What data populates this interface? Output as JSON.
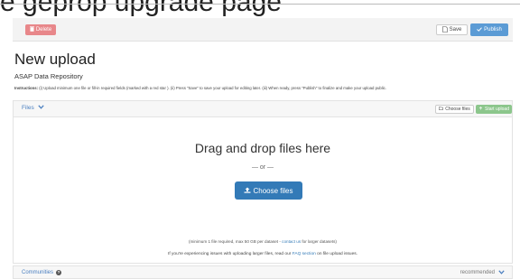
{
  "clipped_heading": "e geprop  upgrade page",
  "toolbar": {
    "delete_label": "Delete",
    "delete_icon": "trash-icon",
    "save_label": "Save",
    "save_icon": "file-icon",
    "publish_label": "Publish",
    "publish_icon": "check-icon"
  },
  "page": {
    "title": "New upload",
    "subtitle": "ASAP Data Repository",
    "instructions_label": "Instructions:",
    "instructions_text": " (i) Upload minimum one file or fill-in required fields (marked with a red star ). (ii) Press \"Save\" to save your upload for editing later. (iii) When ready, press \"Publish\" to finalize and make your upload public."
  },
  "files": {
    "header_label": "Files",
    "choose_small_label": "Choose files",
    "start_upload_label": "Start upload",
    "drop_title": "Drag and drop files here",
    "or_text": "— or —",
    "choose_big_label": "Choose files",
    "note_prefix": "(minimum 1 file required, max 50 GB per dataset - ",
    "note_link": "contact us",
    "note_suffix": " for larger datasets)",
    "issue_prefix": "If you're experiencing issues with uploading larger files, read our ",
    "issue_link": "FAQ section",
    "issue_suffix": " on file upload issues."
  },
  "communities": {
    "label": "Communities",
    "status": "recommended"
  },
  "colors": {
    "delete": "#e8878a",
    "publish": "#5b9bd5",
    "primary": "#337ab7",
    "start_upload": "#8cc68c"
  }
}
